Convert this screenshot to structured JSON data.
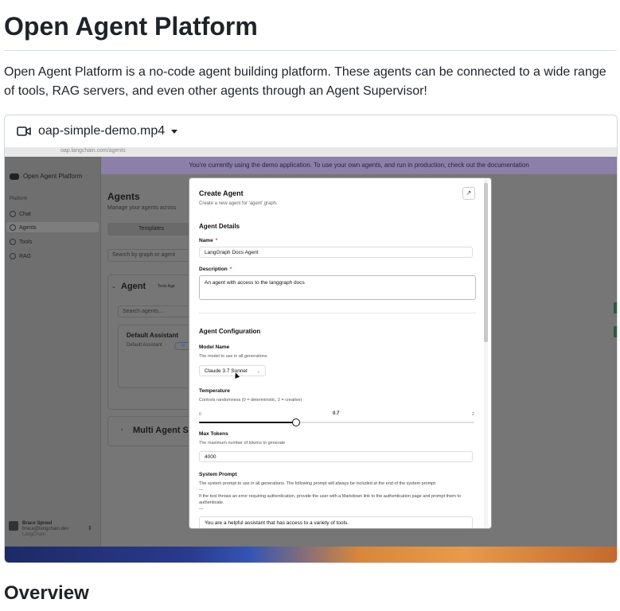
{
  "page": {
    "title": "Open Agent Platform",
    "intro": "Open Agent Platform is a no-code agent building platform. These agents can be connected to a wide range of tools, RAG servers, and even other agents through an Agent Supervisor!",
    "overview_heading": "Overview"
  },
  "video": {
    "icon": "video-camera-icon",
    "filename": "oap-simple-demo.mp4"
  },
  "app": {
    "url": "oap.langchain.com/agents",
    "banner": "You're currently using the demo application. To use your own agents, and run in production, check out the documentation",
    "logo_text": "Open Agent Platform",
    "sidebar_section": "Platform",
    "sidebar_items": [
      {
        "label": "Chat",
        "icon": "chat-icon"
      },
      {
        "label": "Agents",
        "icon": "agents-icon"
      },
      {
        "label": "Tools",
        "icon": "tools-icon"
      },
      {
        "label": "RAG",
        "icon": "rag-icon"
      }
    ],
    "user": {
      "name": "Brace Sproul",
      "email": "brace@langchain.dev",
      "org": "LangChain"
    },
    "agents_heading": "Agents",
    "agents_subtitle": "Manage your agents across",
    "tab_templates": "Templates",
    "search_graph_placeholder": "Search by graph or agent",
    "agent_group_title": "Agent",
    "agent_group_tag": "Tools Age",
    "search_agents_placeholder": "Search agents...",
    "default_assistant_title": "Default Assistant",
    "default_assistant_subtitle": "Default Assistant",
    "default_assistant_badge": "M",
    "multi_agent_title": "Multi Agent S"
  },
  "modal": {
    "title": "Create Agent",
    "subtitle": "Create a new agent for 'agent' graph.",
    "close_icon": "collapse-icon",
    "details_heading": "Agent Details",
    "name_label": "Name",
    "name_value": "LangGraph Docs Agent",
    "description_label": "Description",
    "description_value": "An agent with access to the langgraph docs",
    "required_mark": "*",
    "config_heading": "Agent Configuration",
    "model_label": "Model Name",
    "model_hint": "The model to use in all generations",
    "model_value": "Claude 3.7 Sonnet",
    "temperature_label": "Temperature",
    "temperature_hint": "Controls randomness (0 = deterministic, 2 = creative)",
    "temperature_min": "0",
    "temperature_max": "2",
    "temperature_value_label": "0.7",
    "temperature_value": 0.7,
    "temperature_range": [
      0,
      2
    ],
    "max_tokens_label": "Max Tokens",
    "max_tokens_hint": "The maximum number of tokens to generate",
    "max_tokens_value": "4000",
    "system_prompt_label": "System Prompt",
    "system_prompt_line1": "The system prompt to use in all generations. The following prompt will always be included at the end of the system prompt:",
    "system_prompt_line2": "---",
    "system_prompt_line3": "If the tool throws an error requiring authentication, provide the user with a Markdown link to the authentication page and prompt them to authenticate.",
    "system_prompt_line4": "---",
    "system_prompt_value": "You are a helpful assistant that has access to a variety of tools."
  }
}
